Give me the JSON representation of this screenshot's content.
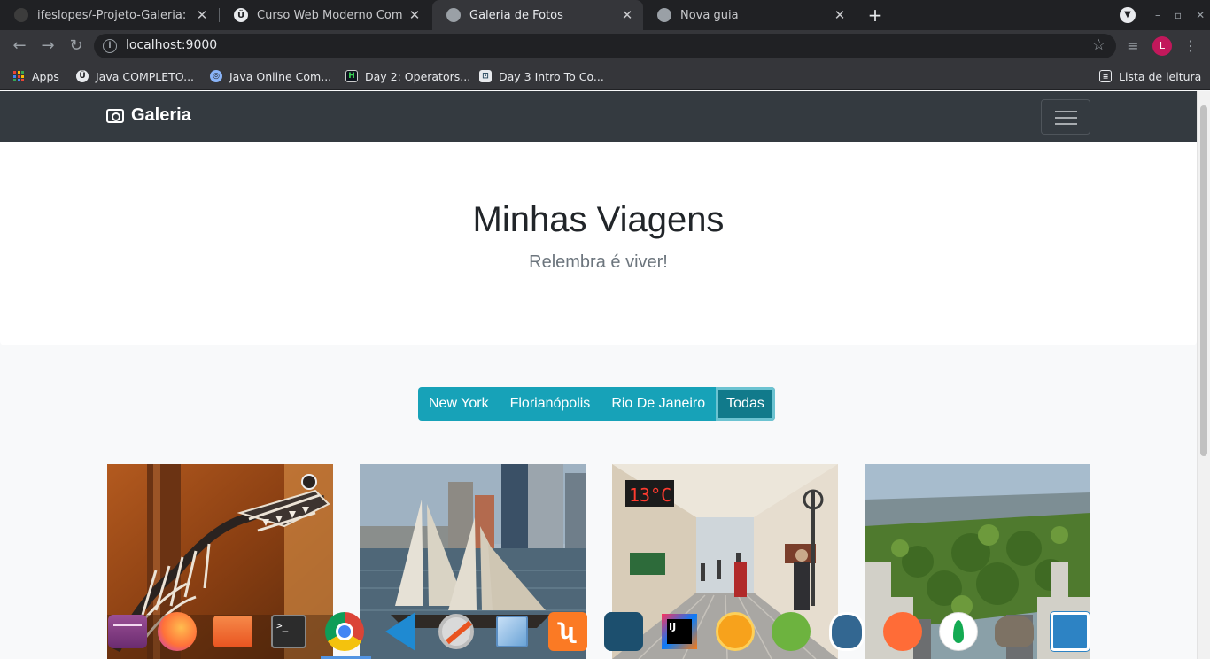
{
  "browser": {
    "tabs": [
      {
        "title": "ifeslopes/-Projeto-Galeria: Pro",
        "icon": "github-icon",
        "active": false
      },
      {
        "title": "Curso Web Moderno Complet",
        "icon": "udemy-icon",
        "active": false
      },
      {
        "title": "Galeria de Fotos",
        "icon": "globe-icon",
        "active": true
      },
      {
        "title": "Nova guia",
        "icon": "chrome-icon",
        "active": false
      }
    ],
    "url": "localhost:9000",
    "profile_initial": "L",
    "bookmarks": [
      {
        "label": "Apps",
        "icon": "apps-grid-icon"
      },
      {
        "label": "Java COMPLETO...",
        "icon": "udemy-icon"
      },
      {
        "label": "Java Online Com...",
        "icon": "java-course-icon"
      },
      {
        "label": "Day 2: Operators...",
        "icon": "hackerrank-icon"
      },
      {
        "label": "Day 3 Intro To Co...",
        "icon": "codecademy-icon"
      }
    ],
    "reading_list": "Lista de leitura"
  },
  "navbar": {
    "brand": "Galeria",
    "brand_icon": "camera-icon",
    "toggler_icon": "hamburger-menu-icon"
  },
  "hero": {
    "title": "Minhas Viagens",
    "subtitle": "Relembra é viver!"
  },
  "filters": {
    "buttons": [
      "New York",
      "Florianópolis",
      "Rio De Janeiro",
      "Todas"
    ],
    "active": "Todas",
    "color": "#17a2b8"
  },
  "photos": [
    {
      "name": "dinosaur-skeleton-museum"
    },
    {
      "name": "sailboat-new-york-harbor"
    },
    {
      "name": "florianopolis-pedestrian-street"
    },
    {
      "name": "central-park-aerial"
    }
  ],
  "dock": {
    "apps": [
      "app-center-icon",
      "firefox-icon",
      "files-icon",
      "terminal-icon",
      "chrome-icon",
      "vscode-icon",
      "settings-tool-icon",
      "virtualbox-icon",
      "xampp-icon",
      "mysql-workbench-icon",
      "intellij-icon",
      "touch-app-icon",
      "spring-icon",
      "postgresql-icon",
      "postman-icon",
      "mongodb-icon",
      "gimp-icon",
      "system-monitor-icon"
    ],
    "running": "chrome-icon"
  }
}
